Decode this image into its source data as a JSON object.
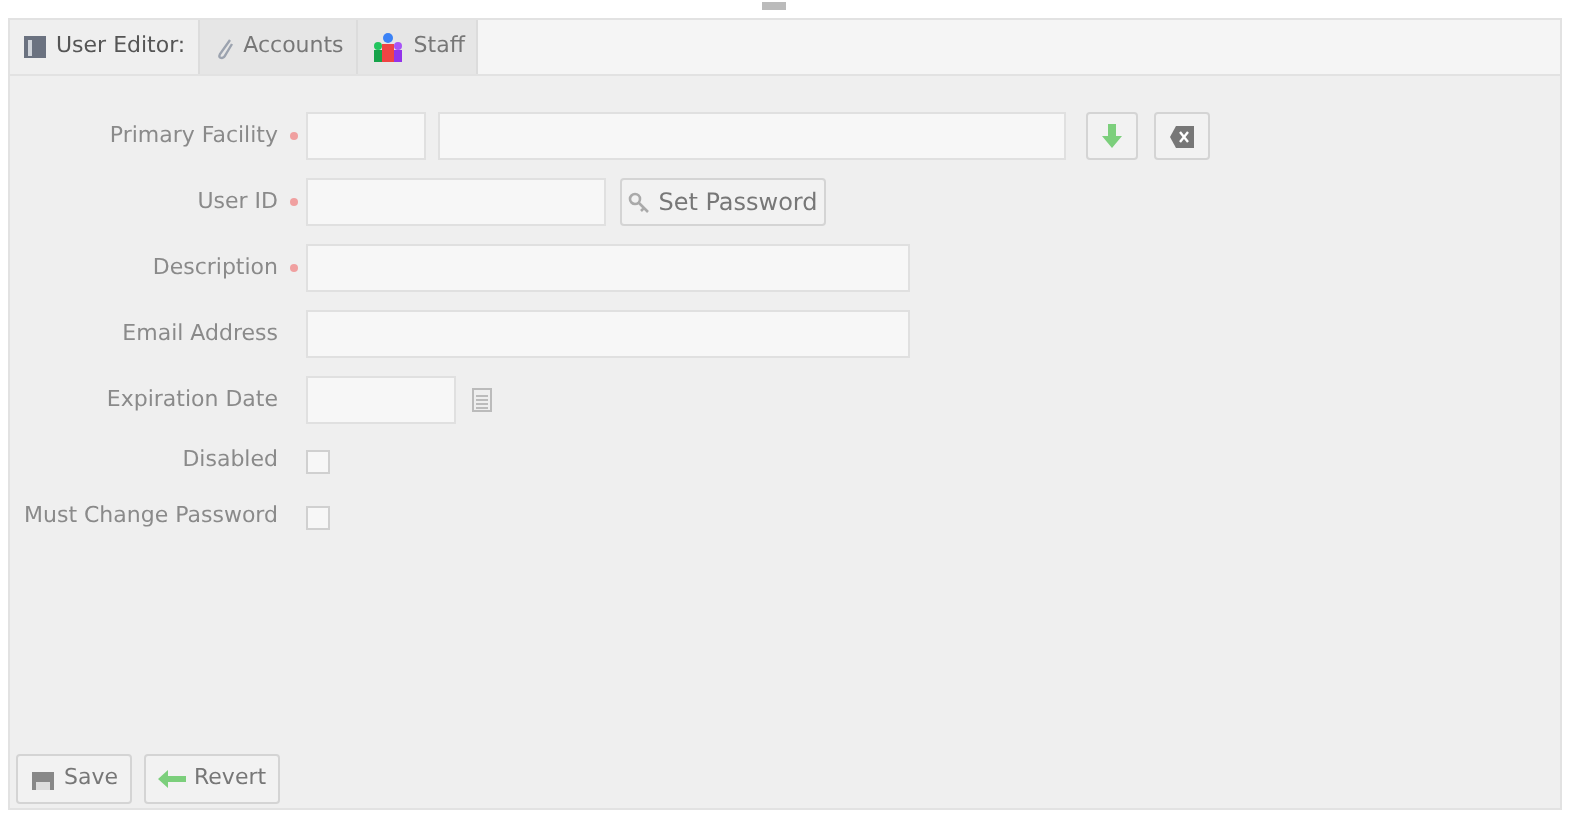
{
  "tabs": [
    {
      "label": "User Editor:",
      "selected": true
    },
    {
      "label": "Accounts",
      "selected": false
    },
    {
      "label": "Staff",
      "selected": false
    }
  ],
  "fields": [
    {
      "kind": "facility",
      "label": "Primary Facility",
      "required": true
    },
    {
      "kind": "userid",
      "label": "User ID",
      "required": true,
      "button": "Set Password"
    },
    {
      "kind": "text",
      "label": "Description",
      "required": true
    },
    {
      "kind": "text",
      "label": "Email Address",
      "required": false
    },
    {
      "kind": "date",
      "label": "Expiration Date",
      "required": false
    },
    {
      "kind": "checkbox",
      "label": "Disabled",
      "required": false,
      "checked": false
    },
    {
      "kind": "checkbox",
      "label": "Must Change Password",
      "required": false,
      "checked": false
    }
  ],
  "buttons": [
    "Save",
    "Revert"
  ]
}
